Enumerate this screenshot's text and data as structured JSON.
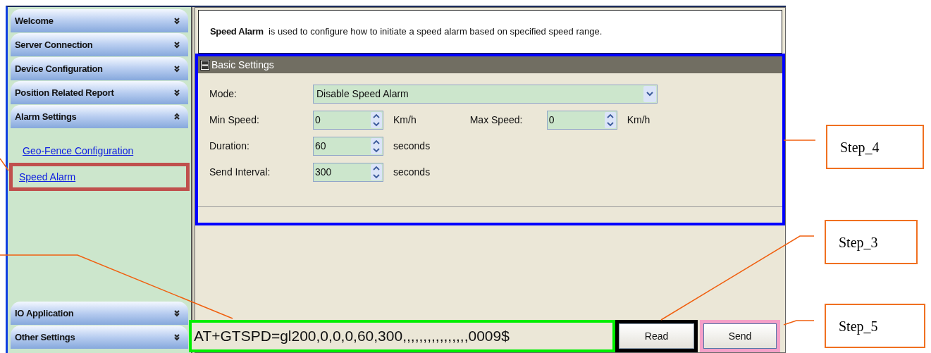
{
  "sidebar": {
    "sections": [
      {
        "label": "Welcome",
        "expanded": false
      },
      {
        "label": "Server Connection",
        "expanded": false
      },
      {
        "label": "Device Configuration",
        "expanded": false
      },
      {
        "label": "Position Related Report",
        "expanded": false
      },
      {
        "label": "Alarm Settings",
        "expanded": true,
        "children": [
          {
            "label": "Geo-Fence Configuration",
            "selected": false
          },
          {
            "label": "Speed Alarm",
            "selected": true
          }
        ]
      },
      {
        "label": "IO Application",
        "expanded": false
      },
      {
        "label": "Other Settings",
        "expanded": false
      }
    ]
  },
  "description": "**Speed Alarm**  is used to configure how to initiate a speed alarm based on specified speed range.",
  "group": {
    "title": "Basic Settings",
    "expanded": true,
    "rows": [
      {
        "kind": "dropdown",
        "label": "Mode:",
        "value": "Disable Speed Alarm"
      },
      {
        "kind": "spinners",
        "fields": [
          {
            "label": "Min Speed:",
            "value": "0",
            "unit": "Km/h"
          },
          {
            "label": "Max Speed:",
            "value": "0",
            "unit": "Km/h"
          }
        ]
      },
      {
        "kind": "spinners",
        "fields": [
          {
            "label": "Duration:",
            "value": "60",
            "unit": "seconds"
          }
        ]
      },
      {
        "kind": "spinners",
        "fields": [
          {
            "label": "Send Interval:",
            "value": "300",
            "unit": "seconds"
          }
        ]
      }
    ]
  },
  "command": "AT+GTSPD=gl200,0,0,0,60,300,,,,,,,,,,,,,,,,0009$",
  "buttons": [
    "Read",
    "Send"
  ],
  "annotations": [
    "Step_4",
    "Step_3",
    "Step_5"
  ]
}
